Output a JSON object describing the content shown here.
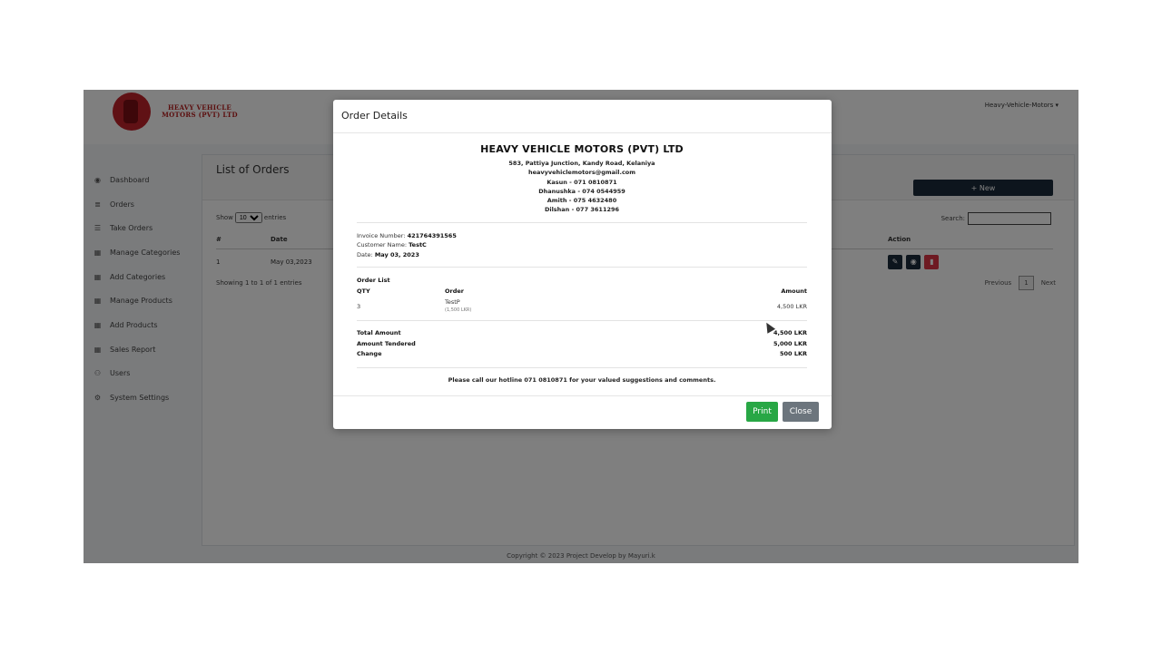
{
  "header": {
    "logo_text": "HEAVY VEHICLE MOTORS (PVT) LTD",
    "user_menu": "Heavy-Vehicle-Motors ▾"
  },
  "sidebar": {
    "items": [
      {
        "label": "Dashboard",
        "icon": "dashboard-icon"
      },
      {
        "label": "Orders",
        "icon": "list-icon"
      },
      {
        "label": "Take Orders",
        "icon": "list-icon"
      },
      {
        "label": "Manage Categories",
        "icon": "grid-icon"
      },
      {
        "label": "Add Categories",
        "icon": "grid-icon"
      },
      {
        "label": "Manage Products",
        "icon": "grid-icon"
      },
      {
        "label": "Add Products",
        "icon": "grid-icon"
      },
      {
        "label": "Sales Report",
        "icon": "grid-icon"
      },
      {
        "label": "Users",
        "icon": "users-icon"
      },
      {
        "label": "System Settings",
        "icon": "settings-icon"
      }
    ]
  },
  "orders_page": {
    "title": "List of Orders",
    "new_button": "+ New",
    "show_label": "Show",
    "entries_value": "10",
    "entries_label": "entries",
    "search_label": "Search:",
    "columns": [
      "#",
      "Date",
      "Action"
    ],
    "rows": [
      {
        "num": "1",
        "date": "May 03,2023"
      }
    ],
    "showing_text": "Showing 1 to 1 of 1 entries",
    "pager": {
      "previous": "Previous",
      "page": "1",
      "next": "Next"
    }
  },
  "footer": {
    "text": "Copyright © 2023 Project Develop by Mayuri.k"
  },
  "modal": {
    "title": "Order Details",
    "company": {
      "name": "HEAVY VEHICLE MOTORS (PVT) LTD",
      "address": "583, Pattiya Junction, Kandy Road, Kelaniya",
      "email": "heavyvehiclemotors@gmail.com",
      "contacts": [
        "Kasun - 071 0810871",
        "Dhanushka - 074 0544959",
        "Amith - 075 4632480",
        "Dilshan - 077 3611296"
      ]
    },
    "invoice": {
      "invoice_label": "Invoice Number:",
      "invoice_value": "421764391565",
      "customer_label": "Customer Name:",
      "customer_value": "TestC",
      "date_label": "Date:",
      "date_value": "May 03, 2023"
    },
    "order_list": {
      "title": "Order List",
      "headers": {
        "qty": "QTY",
        "order": "Order",
        "amount": "Amount"
      },
      "items": [
        {
          "qty": "3",
          "name": "TestP",
          "unit": "(1,500 LKR)",
          "amount": "4,500 LKR"
        }
      ]
    },
    "totals": {
      "total_label": "Total Amount",
      "total_value": "4,500 LKR",
      "tendered_label": "Amount Tendered",
      "tendered_value": "5,000 LKR",
      "change_label": "Change",
      "change_value": "500 LKR"
    },
    "hotline": "Please call our hotline 071 0810871 for your valued suggestions and comments.",
    "print_button": "Print",
    "close_button": "Close"
  },
  "colors": {
    "print": "#28a745",
    "close": "#6c757d",
    "new": "#1b2b3a",
    "edit": "#1b2b3a",
    "view": "#1b2b3a",
    "delete": "#dc3545",
    "brand_red": "#c0222a"
  }
}
